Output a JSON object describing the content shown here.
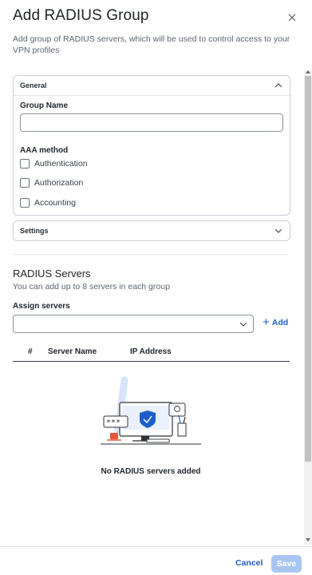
{
  "dialog": {
    "title": "Add RADIUS Group",
    "description": "Add group of RADIUS servers, which will be used to control access to your VPN profiles"
  },
  "general": {
    "title": "General",
    "group_name_label": "Group Name",
    "group_name_value": "",
    "aaa_label": "AAA method",
    "methods": [
      {
        "label": "Authentication",
        "checked": false
      },
      {
        "label": "Authorization",
        "checked": false
      },
      {
        "label": "Accounting",
        "checked": false
      }
    ]
  },
  "settings": {
    "title": "Settings"
  },
  "servers": {
    "title": "RADIUS Servers",
    "subtitle": "You can add up to 8 servers in each group",
    "assign_label": "Assign servers",
    "assign_value": "",
    "add_label": "Add",
    "columns": [
      "#",
      "Server Name",
      "IP Address"
    ],
    "empty_text": "No RADIUS servers added"
  },
  "footer": {
    "cancel_label": "Cancel",
    "save_label": "Save"
  },
  "colors": {
    "accent": "#1d5fc9",
    "save_disabled": "#a9c6f3"
  }
}
